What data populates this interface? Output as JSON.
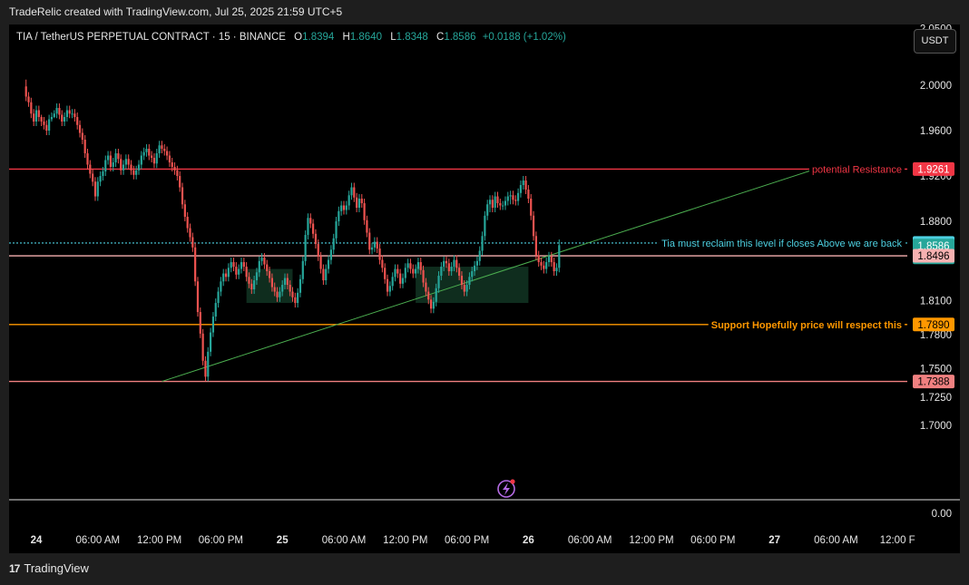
{
  "caption": "TradeRelic created with TradingView.com, Jul 25, 2025 21:59 UTC+5",
  "footer": {
    "brand": "TradingView",
    "logo_text": "17"
  },
  "legend": {
    "symbol": "TIA / TetherUS PERPETUAL CONTRACT · 15 · BINANCE",
    "open_label": "O",
    "open": "1.8394",
    "high_label": "H",
    "high": "1.8640",
    "low_label": "L",
    "low": "1.8348",
    "close_label": "C",
    "close": "1.8586",
    "change": "+0.0188 (+1.02%)"
  },
  "currency_button": "USDT",
  "colors": {
    "up": "#26a69a",
    "down": "#ef5350",
    "resistance": "#f23645",
    "support": "#ff9800",
    "dotted": "#4dd0e1",
    "trend": "#4caf50",
    "zone": "#0f2d1e",
    "bottom_line": "#e0e0e0"
  },
  "chart_data": {
    "type": "candlestick",
    "symbol": "TIA / TetherUS PERPETUAL CONTRACT",
    "timeframe": "15",
    "exchange": "BINANCE",
    "y_axis_ticks": [
      "2.0500",
      "2.0000",
      "1.9600",
      "1.9200",
      "1.8800",
      "1.8100",
      "1.7800",
      "1.7500",
      "1.7250",
      "1.7000",
      "0.00"
    ],
    "x_axis_ticks": [
      "24",
      "06:00 AM",
      "12:00 PM",
      "06:00 PM",
      "25",
      "06:00 AM",
      "12:00 PM",
      "06:00 PM",
      "26",
      "06:00 AM",
      "12:00 PM",
      "06:00 PM",
      "27",
      "06:00 AM",
      "12:00 F"
    ],
    "price_labels": [
      {
        "value": "1.9261",
        "color": "#f23645",
        "text_color": "#ffffff"
      },
      {
        "value": "1.8609",
        "color": "#4dd0e1",
        "text_color": "#000000"
      },
      {
        "value": "1.8586",
        "color": "#26a69a",
        "text_color": "#ffffff",
        "countdown": "00:01"
      },
      {
        "value": "1.8496",
        "color": "#f7b1b1",
        "text_color": "#000000"
      },
      {
        "value": "1.7890",
        "color": "#ff9800",
        "text_color": "#000000"
      },
      {
        "value": "1.7388",
        "color": "#f08080",
        "text_color": "#000000"
      }
    ],
    "horizontal_lines": [
      {
        "value": 1.9261,
        "style": "solid",
        "color": "#f23645",
        "label": "potential Resistance"
      },
      {
        "value": 1.8609,
        "style": "dotted",
        "color": "#4dd0e1",
        "label": "Tia must reclaim this level if closes Above we are back"
      },
      {
        "value": 1.8496,
        "style": "solid",
        "color": "#f7b1b1",
        "label": ""
      },
      {
        "value": 1.789,
        "style": "solid",
        "color": "#ff9800",
        "label": "Support Hopefully price will respect this"
      },
      {
        "value": 1.7388,
        "style": "solid",
        "color": "#f08080",
        "label": ""
      }
    ],
    "trendline": {
      "from": {
        "date": "Jul 24 12:15 PM",
        "price": 1.7388
      },
      "to": {
        "date": "Jul 27 04:00 AM",
        "price": 1.9261
      }
    },
    "zones": [
      {
        "from": "Jul 24 08:30 PM",
        "to": "Jul 25 01:00 AM",
        "top": 1.838,
        "bottom": 1.808
      },
      {
        "from": "Jul 25 01:00 PM",
        "to": "Jul 26 12:00 AM",
        "top": 1.84,
        "bottom": 1.808
      }
    ],
    "candles": {
      "interval_minutes": 15,
      "first": "Jul 23 11:00 PM",
      "open": [
        1.999,
        1.99,
        1.985,
        1.975,
        1.968,
        1.978,
        1.972,
        1.968,
        1.965,
        1.96,
        1.97,
        1.972,
        1.975,
        1.98,
        1.974,
        1.968,
        1.972,
        1.978,
        1.975,
        1.975,
        1.972,
        1.965,
        1.958,
        1.952,
        1.94,
        1.93,
        1.922,
        1.915,
        1.902,
        1.915,
        1.92,
        1.924,
        1.934,
        1.938,
        1.928,
        1.932,
        1.94,
        1.935,
        1.925,
        1.93,
        1.935,
        1.93,
        1.925,
        1.921,
        1.925,
        1.93,
        1.938,
        1.941,
        1.944,
        1.938,
        1.936,
        1.931,
        1.94,
        1.947,
        1.944,
        1.942,
        1.938,
        1.932,
        1.928,
        1.925,
        1.92,
        1.91,
        1.895,
        1.884,
        1.874,
        1.866,
        1.857,
        1.827,
        1.8,
        1.781,
        1.757,
        1.743,
        1.765,
        1.782,
        1.796,
        1.808,
        1.818,
        1.827,
        1.834,
        1.831,
        1.839,
        1.844,
        1.84,
        1.833,
        1.838,
        1.844,
        1.84,
        1.831,
        1.825,
        1.82,
        1.828,
        1.835,
        1.845,
        1.848,
        1.842,
        1.836,
        1.83,
        1.822,
        1.818,
        1.813,
        1.818,
        1.824,
        1.83,
        1.824,
        1.818,
        1.813,
        1.808,
        1.817,
        1.829,
        1.845,
        1.868,
        1.883,
        1.878,
        1.869,
        1.86,
        1.849,
        1.838,
        1.828,
        1.838,
        1.846,
        1.855,
        1.865,
        1.88,
        1.889,
        1.894,
        1.89,
        1.894,
        1.903,
        1.91,
        1.901,
        1.892,
        1.9,
        1.896,
        1.881,
        1.87,
        1.855,
        1.857,
        1.862,
        1.856,
        1.846,
        1.839,
        1.829,
        1.818,
        1.823,
        1.831,
        1.838,
        1.834,
        1.825,
        1.83,
        1.839,
        1.843,
        1.838,
        1.834,
        1.838,
        1.844,
        1.837,
        1.826,
        1.818,
        1.811,
        1.803,
        1.809,
        1.821,
        1.832,
        1.84,
        1.845,
        1.843,
        1.836,
        1.84,
        1.846,
        1.839,
        1.832,
        1.824,
        1.818,
        1.824,
        1.831,
        1.836,
        1.841,
        1.845,
        1.854,
        1.867,
        1.885,
        1.895,
        1.899,
        1.892,
        1.902,
        1.896,
        1.894,
        1.894,
        1.898,
        1.902,
        1.903,
        1.899,
        1.898,
        1.905,
        1.912,
        1.916,
        1.908,
        1.9,
        1.885,
        1.867,
        1.85,
        1.844,
        1.841,
        1.838,
        1.844,
        1.849,
        1.844,
        1.836,
        1.839
      ],
      "close": [
        1.99,
        1.985,
        1.975,
        1.968,
        1.978,
        1.972,
        1.968,
        1.965,
        1.96,
        1.97,
        1.972,
        1.975,
        1.98,
        1.974,
        1.968,
        1.972,
        1.978,
        1.975,
        1.975,
        1.972,
        1.965,
        1.958,
        1.952,
        1.94,
        1.93,
        1.922,
        1.915,
        1.902,
        1.915,
        1.92,
        1.924,
        1.934,
        1.938,
        1.928,
        1.932,
        1.94,
        1.935,
        1.925,
        1.93,
        1.935,
        1.93,
        1.925,
        1.921,
        1.925,
        1.93,
        1.938,
        1.941,
        1.944,
        1.938,
        1.936,
        1.931,
        1.94,
        1.947,
        1.944,
        1.942,
        1.938,
        1.932,
        1.928,
        1.925,
        1.92,
        1.91,
        1.895,
        1.884,
        1.874,
        1.866,
        1.857,
        1.827,
        1.8,
        1.781,
        1.757,
        1.743,
        1.765,
        1.782,
        1.796,
        1.808,
        1.818,
        1.827,
        1.834,
        1.831,
        1.839,
        1.844,
        1.84,
        1.833,
        1.838,
        1.844,
        1.84,
        1.831,
        1.825,
        1.82,
        1.828,
        1.835,
        1.845,
        1.848,
        1.842,
        1.836,
        1.83,
        1.822,
        1.818,
        1.813,
        1.818,
        1.824,
        1.83,
        1.824,
        1.818,
        1.813,
        1.808,
        1.817,
        1.829,
        1.845,
        1.868,
        1.883,
        1.878,
        1.869,
        1.86,
        1.849,
        1.838,
        1.828,
        1.838,
        1.846,
        1.855,
        1.865,
        1.88,
        1.889,
        1.894,
        1.89,
        1.894,
        1.903,
        1.91,
        1.901,
        1.892,
        1.9,
        1.896,
        1.881,
        1.87,
        1.855,
        1.857,
        1.862,
        1.856,
        1.846,
        1.839,
        1.829,
        1.818,
        1.823,
        1.831,
        1.838,
        1.834,
        1.825,
        1.83,
        1.839,
        1.843,
        1.838,
        1.834,
        1.838,
        1.844,
        1.837,
        1.826,
        1.818,
        1.811,
        1.803,
        1.809,
        1.821,
        1.832,
        1.84,
        1.845,
        1.843,
        1.836,
        1.84,
        1.846,
        1.839,
        1.832,
        1.824,
        1.818,
        1.824,
        1.831,
        1.836,
        1.841,
        1.845,
        1.854,
        1.867,
        1.885,
        1.895,
        1.899,
        1.892,
        1.902,
        1.896,
        1.894,
        1.894,
        1.898,
        1.902,
        1.903,
        1.899,
        1.898,
        1.905,
        1.912,
        1.916,
        1.908,
        1.9,
        1.885,
        1.867,
        1.85,
        1.844,
        1.841,
        1.838,
        1.844,
        1.849,
        1.844,
        1.836,
        1.839,
        1.859
      ],
      "high": [
        2.005,
        1.994,
        1.989,
        1.979,
        1.982,
        1.982,
        1.974,
        1.972,
        1.969,
        1.974,
        1.976,
        1.978,
        1.984,
        1.984,
        1.978,
        1.976,
        1.982,
        1.982,
        1.979,
        1.979,
        1.976,
        1.969,
        1.962,
        1.956,
        1.944,
        1.934,
        1.926,
        1.919,
        1.919,
        1.924,
        1.928,
        1.938,
        1.942,
        1.942,
        1.936,
        1.944,
        1.944,
        1.939,
        1.934,
        1.939,
        1.939,
        1.934,
        1.929,
        1.929,
        1.934,
        1.942,
        1.945,
        1.948,
        1.948,
        1.942,
        1.94,
        1.944,
        1.951,
        1.951,
        1.948,
        1.946,
        1.942,
        1.936,
        1.932,
        1.929,
        1.924,
        1.914,
        1.899,
        1.888,
        1.878,
        1.87,
        1.861,
        1.831,
        1.804,
        1.785,
        1.761,
        1.769,
        1.786,
        1.8,
        1.812,
        1.822,
        1.831,
        1.838,
        1.838,
        1.843,
        1.848,
        1.848,
        1.844,
        1.842,
        1.848,
        1.848,
        1.844,
        1.835,
        1.829,
        1.832,
        1.839,
        1.849,
        1.852,
        1.852,
        1.846,
        1.84,
        1.834,
        1.826,
        1.822,
        1.822,
        1.828,
        1.834,
        1.834,
        1.828,
        1.822,
        1.817,
        1.821,
        1.833,
        1.849,
        1.872,
        1.887,
        1.887,
        1.882,
        1.873,
        1.864,
        1.853,
        1.842,
        1.842,
        1.85,
        1.859,
        1.869,
        1.884,
        1.893,
        1.898,
        1.898,
        1.898,
        1.907,
        1.914,
        1.914,
        1.905,
        1.904,
        1.904,
        1.9,
        1.885,
        1.874,
        1.861,
        1.866,
        1.866,
        1.86,
        1.85,
        1.843,
        1.833,
        1.827,
        1.835,
        1.842,
        1.842,
        1.838,
        1.834,
        1.843,
        1.847,
        1.847,
        1.842,
        1.842,
        1.848,
        1.848,
        1.841,
        1.83,
        1.822,
        1.815,
        1.813,
        1.825,
        1.836,
        1.844,
        1.849,
        1.849,
        1.847,
        1.844,
        1.85,
        1.85,
        1.843,
        1.836,
        1.828,
        1.828,
        1.835,
        1.84,
        1.845,
        1.849,
        1.858,
        1.871,
        1.889,
        1.899,
        1.903,
        1.903,
        1.906,
        1.906,
        1.9,
        1.898,
        1.902,
        1.906,
        1.907,
        1.907,
        1.903,
        1.909,
        1.916,
        1.92,
        1.92,
        1.912,
        1.904,
        1.889,
        1.871,
        1.854,
        1.848,
        1.845,
        1.848,
        1.853,
        1.853,
        1.848,
        1.843,
        1.864
      ],
      "low": [
        1.986,
        1.981,
        1.971,
        1.964,
        1.964,
        1.968,
        1.964,
        1.961,
        1.956,
        1.956,
        1.968,
        1.971,
        1.971,
        1.97,
        1.964,
        1.964,
        1.968,
        1.971,
        1.971,
        1.968,
        1.961,
        1.954,
        1.948,
        1.936,
        1.926,
        1.918,
        1.911,
        1.898,
        1.898,
        1.911,
        1.916,
        1.92,
        1.93,
        1.924,
        1.924,
        1.928,
        1.931,
        1.921,
        1.921,
        1.926,
        1.926,
        1.921,
        1.917,
        1.917,
        1.921,
        1.926,
        1.934,
        1.937,
        1.934,
        1.932,
        1.927,
        1.927,
        1.936,
        1.94,
        1.938,
        1.934,
        1.928,
        1.924,
        1.921,
        1.916,
        1.906,
        1.891,
        1.88,
        1.87,
        1.862,
        1.853,
        1.823,
        1.796,
        1.777,
        1.753,
        1.739,
        1.739,
        1.761,
        1.778,
        1.792,
        1.804,
        1.814,
        1.823,
        1.827,
        1.827,
        1.835,
        1.836,
        1.829,
        1.829,
        1.834,
        1.836,
        1.827,
        1.821,
        1.816,
        1.816,
        1.824,
        1.831,
        1.841,
        1.838,
        1.832,
        1.826,
        1.818,
        1.814,
        1.809,
        1.809,
        1.814,
        1.82,
        1.82,
        1.814,
        1.809,
        1.804,
        1.804,
        1.813,
        1.825,
        1.841,
        1.864,
        1.874,
        1.865,
        1.856,
        1.845,
        1.834,
        1.824,
        1.824,
        1.834,
        1.842,
        1.851,
        1.861,
        1.876,
        1.885,
        1.886,
        1.886,
        1.89,
        1.899,
        1.897,
        1.888,
        1.888,
        1.892,
        1.877,
        1.866,
        1.851,
        1.851,
        1.853,
        1.852,
        1.842,
        1.835,
        1.825,
        1.814,
        1.814,
        1.819,
        1.827,
        1.83,
        1.821,
        1.821,
        1.826,
        1.835,
        1.834,
        1.83,
        1.83,
        1.834,
        1.833,
        1.822,
        1.814,
        1.807,
        1.799,
        1.799,
        1.805,
        1.817,
        1.828,
        1.836,
        1.839,
        1.832,
        1.832,
        1.836,
        1.835,
        1.828,
        1.82,
        1.814,
        1.814,
        1.82,
        1.827,
        1.832,
        1.837,
        1.841,
        1.85,
        1.863,
        1.881,
        1.888,
        1.888,
        1.888,
        1.892,
        1.89,
        1.89,
        1.89,
        1.894,
        1.895,
        1.895,
        1.894,
        1.894,
        1.901,
        1.908,
        1.904,
        1.896,
        1.881,
        1.863,
        1.846,
        1.84,
        1.837,
        1.834,
        1.834,
        1.84,
        1.84,
        1.832,
        1.832,
        1.835
      ]
    }
  }
}
